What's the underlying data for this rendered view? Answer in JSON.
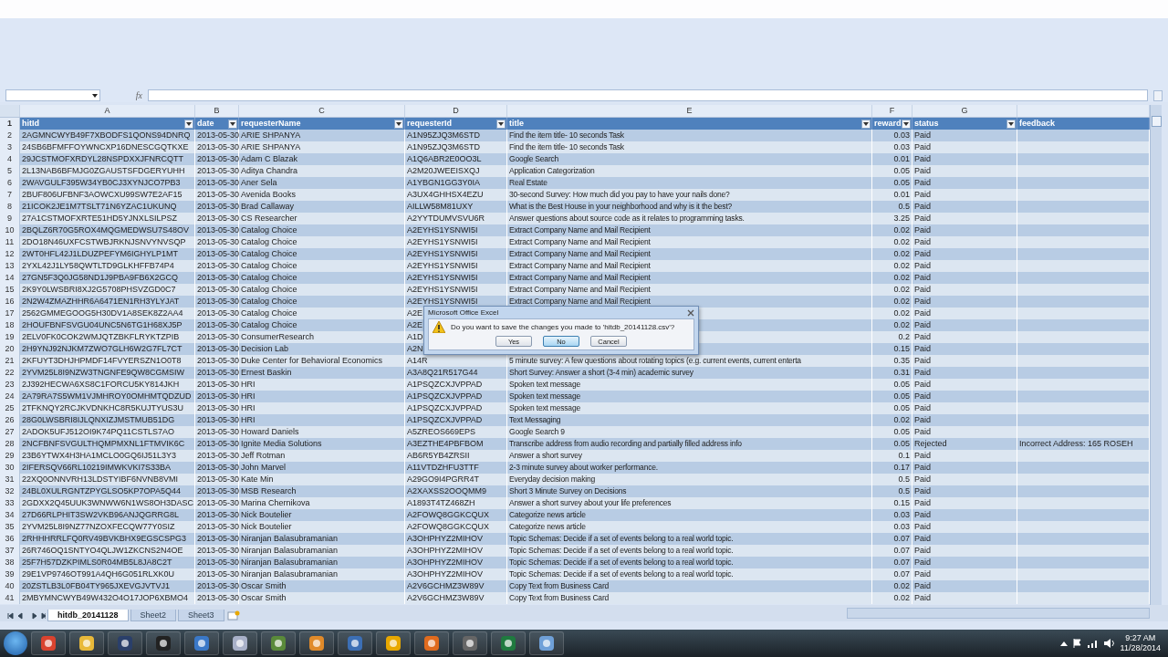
{
  "formula_bar": {
    "fx": "fx"
  },
  "columns": [
    {
      "letter": "A",
      "header": "hitId",
      "filter": true
    },
    {
      "letter": "B",
      "header": "date",
      "filter": true
    },
    {
      "letter": "C",
      "header": "requesterName",
      "filter": true
    },
    {
      "letter": "D",
      "header": "requesterId",
      "filter": true
    },
    {
      "letter": "E",
      "header": "title",
      "filter": true
    },
    {
      "letter": "F",
      "header": "reward",
      "filter": true
    },
    {
      "letter": "G",
      "header": "status",
      "filter": true
    },
    {
      "header": "feedback",
      "filter": false
    }
  ],
  "header_row": "1",
  "rows": [
    {
      "num": "2",
      "a": "2AGMNCWYB49F7XBODFS1QONS94DNRQ",
      "b": "2013-05-30",
      "c": "ARIE SHPANYA",
      "d": "A1N95ZJQ3M6STD",
      "e": "Find the item title- 10 seconds Task",
      "f": "0.03",
      "g": "Paid"
    },
    {
      "num": "3",
      "a": "24SB6BFMFFOYWNCXP16DNESCGQTKXE",
      "b": "2013-05-30",
      "c": "ARIE SHPANYA",
      "d": "A1N95ZJQ3M6STD",
      "e": "Find the item title- 10 seconds Task",
      "f": "0.03",
      "g": "Paid"
    },
    {
      "num": "4",
      "a": "29JCSTMOFXRDYL28NSPDXXJFNRCQTT",
      "b": "2013-05-30",
      "c": "Adam C Blazak",
      "d": "A1Q6ABR2E0OO3L",
      "e": "Google Search",
      "f": "0.01",
      "g": "Paid"
    },
    {
      "num": "5",
      "a": "2L13NAB6BFMJG0ZGAUSTSFDGERYUHH",
      "b": "2013-05-30",
      "c": "Aditya Chandra",
      "d": "A2M20JWEEISXQJ",
      "e": "Application Categorization",
      "f": "0.05",
      "g": "Paid"
    },
    {
      "num": "6",
      "a": "2WAVGULF395W34YB0CJ3XYNJCO7PB3",
      "b": "2013-05-30",
      "c": "Aner Sela",
      "d": "A1YBGN1GG3Y0IA",
      "e": "Real Estate",
      "f": "0.05",
      "g": "Paid"
    },
    {
      "num": "7",
      "a": "2BUF806UFBNF3AOWCXU99SW7E2AF15",
      "b": "2013-05-30",
      "c": "Avenida Books",
      "d": "A3UX4GHHSX4EZU",
      "e": "30-second Survey: How much did you pay to have your nails done?",
      "f": "0.01",
      "g": "Paid"
    },
    {
      "num": "8",
      "a": "21ICOK2JE1M7TSLT71N6YZAC1UKUNQ",
      "b": "2013-05-30",
      "c": "Brad Callaway",
      "d": "AILLW58M81UXY",
      "e": "What is the Best House in your neighborhood and why is it the best?",
      "f": "0.5",
      "g": "Paid"
    },
    {
      "num": "9",
      "a": "27A1CSTMOFXRTE51HD5YJNXLSILPSZ",
      "b": "2013-05-30",
      "c": "CS Researcher",
      "d": "A2YYTDUMVSVU6R",
      "e": "Answer questions about source code as it relates to programming tasks.",
      "f": "3.25",
      "g": "Paid"
    },
    {
      "num": "10",
      "a": "2BQLZ6R70G5ROX4MQGMEDWSU7S48OV",
      "b": "2013-05-30",
      "c": "Catalog Choice",
      "d": "A2EYHS1YSNWI5I",
      "e": "Extract Company Name and Mail Recipient",
      "f": "0.02",
      "g": "Paid"
    },
    {
      "num": "11",
      "a": "2DO18N46UXFCSTWBJRKNJSNVYNVSQP",
      "b": "2013-05-30",
      "c": "Catalog Choice",
      "d": "A2EYHS1YSNWI5I",
      "e": "Extract Company Name and Mail Recipient",
      "f": "0.02",
      "g": "Paid"
    },
    {
      "num": "12",
      "a": "2WT0HFL42J1LDUZPEFYM6IGHYLP1MT",
      "b": "2013-05-30",
      "c": "Catalog Choice",
      "d": "A2EYHS1YSNWI5I",
      "e": "Extract Company Name and Mail Recipient",
      "f": "0.02",
      "g": "Paid"
    },
    {
      "num": "13",
      "a": "2YXL42J1LY58QWTLTD9GLKHFFB74P4",
      "b": "2013-05-30",
      "c": "Catalog Choice",
      "d": "A2EYHS1YSNWI5I",
      "e": "Extract Company Name and Mail Recipient",
      "f": "0.02",
      "g": "Paid"
    },
    {
      "num": "14",
      "a": "27GN5F3Q0JG58ND1J9PBA9FB6X2GCQ",
      "b": "2013-05-30",
      "c": "Catalog Choice",
      "d": "A2EYHS1YSNWI5I",
      "e": "Extract Company Name and Mail Recipient",
      "f": "0.02",
      "g": "Paid"
    },
    {
      "num": "15",
      "a": "2K9Y0LWSBRI8XJ2G5708PHSVZGD0C7",
      "b": "2013-05-30",
      "c": "Catalog Choice",
      "d": "A2EYHS1YSNWI5I",
      "e": "Extract Company Name and Mail Recipient",
      "f": "0.02",
      "g": "Paid"
    },
    {
      "num": "16",
      "a": "2N2W4ZMAZHHR6A6471EN1RH3YLYJAT",
      "b": "2013-05-30",
      "c": "Catalog Choice",
      "d": "A2EYHS1YSNWI5I",
      "e": "Extract Company Name and Mail Recipient",
      "f": "0.02",
      "g": "Paid"
    },
    {
      "num": "17",
      "a": "2562GMMEGOOG5H30DV1A8SEK8Z2AA4",
      "b": "2013-05-30",
      "c": "Catalog Choice",
      "d": "A2E",
      "f": "0.02",
      "g": "Paid"
    },
    {
      "num": "18",
      "a": "2HOUFBNFSVGU04UNC5N6TG1H68XJ5P",
      "b": "2013-05-30",
      "c": "Catalog Choice",
      "d": "A2E",
      "f": "0.02",
      "g": "Paid"
    },
    {
      "num": "19",
      "a": "2ELV0FK0COK2WMJQTZBKFLRYKTZPIB",
      "b": "2013-05-30",
      "c": "ConsumerResearch",
      "d": "A1D",
      "f": "0.2",
      "g": "Paid"
    },
    {
      "num": "20",
      "a": "2H9YNJ92NJKM7ZWO7GLH6W2G7FL7CT",
      "b": "2013-05-30",
      "c": "Decision Lab",
      "d": "A2N",
      "f": "0.15",
      "g": "Paid"
    },
    {
      "num": "21",
      "a": "2KFUYT3DHJHPMDF14FVYERSZN1O0T8",
      "b": "2013-05-30",
      "c": "Duke Center for Behavioral Economics",
      "d": "A14R",
      "e": "5 minute survey: A few questions about rotating topics (e.g. current events,  current enterta",
      "f": "0.35",
      "g": "Paid"
    },
    {
      "num": "22",
      "a": "2YVM25L8I9NZW3TNGNFE9QW8CGMSIW",
      "b": "2013-05-30",
      "c": "Ernest Baskin",
      "d": "A3A8Q21R517G44",
      "e": "Short Survey: Answer a short (3-4 min) academic survey",
      "f": "0.31",
      "g": "Paid"
    },
    {
      "num": "23",
      "a": "2J392HECWA6XS8C1FORCU5KY814JKH",
      "b": "2013-05-30",
      "c": "HRI",
      "d": "A1PSQZCXJVPPAD",
      "e": "Spoken text message",
      "f": "0.05",
      "g": "Paid"
    },
    {
      "num": "24",
      "a": "2A79RA7S5WM1VJMHROY0OMHMTQDZUD",
      "b": "2013-05-30",
      "c": "HRI",
      "d": "A1PSQZCXJVPPAD",
      "e": "Spoken text message",
      "f": "0.05",
      "g": "Paid"
    },
    {
      "num": "25",
      "a": "2TFKNQY2RCJKVDNKHC8R5KUJTYUS3U",
      "b": "2013-05-30",
      "c": "HRI",
      "d": "A1PSQZCXJVPPAD",
      "e": "Spoken text message",
      "f": "0.05",
      "g": "Paid"
    },
    {
      "num": "26",
      "a": "28G0LWSBRI8IJLQNXIZJMSTMUB51DG",
      "b": "2013-05-30",
      "c": "HRI",
      "d": "A1PSQZCXJVPPAD",
      "e": "Text Messaging",
      "f": "0.02",
      "g": "Paid"
    },
    {
      "num": "27",
      "a": "2ADOK5UFJ512OI9K74PQ11CSTLS7AO",
      "b": "2013-05-30",
      "c": "Howard Daniels",
      "d": "A5ZREOS669EPS",
      "e": "Google Search 9",
      "f": "0.05",
      "g": "Paid"
    },
    {
      "num": "28",
      "a": "2NCFBNFSVGULTHQMPMXNL1FTMVIK6C",
      "b": "2013-05-30",
      "c": "Ignite Media Solutions",
      "d": "A3EZTHE4PBFBOM",
      "e": "Transcribe address from audio recording and partially filled address info",
      "f": "0.05",
      "g": "Rejected",
      "h": "Incorrect Address: 165 ROSEH"
    },
    {
      "num": "29",
      "a": "23B6YTWX4H3HA1MCLO0GQ6IJ51L3Y3",
      "b": "2013-05-30",
      "c": "Jeff Rotman",
      "d": "AB6R5YB4ZRSII",
      "e": "Answer a short survey",
      "f": "0.1",
      "g": "Paid"
    },
    {
      "num": "30",
      "a": "2IFERSQV66RL10219IMWKVKI7S33BA",
      "b": "2013-05-30",
      "c": "John Marvel",
      "d": "A11VTDZHFU3TTF",
      "e": "2-3 minute survey about worker performance.",
      "f": "0.17",
      "g": "Paid"
    },
    {
      "num": "31",
      "a": "22XQ0ONNVRH13LDSTYIBF6NVNB8VMI",
      "b": "2013-05-30",
      "c": "Kate Min",
      "d": "A29GO9I4PGRR4T",
      "e": "Everyday decision making",
      "f": "0.5",
      "g": "Paid"
    },
    {
      "num": "32",
      "a": "24BL0XULRGNTZPYGLSO5KP7OPA5Q44",
      "b": "2013-05-30",
      "c": "MSB Research",
      "d": "A2XAXSS2OOQMM9",
      "e": "Short 3 Minute Survey on Decisions",
      "f": "0.5",
      "g": "Paid"
    },
    {
      "num": "33",
      "a": "2GDXX2Q45UUK3WNWW6N1WS8OH3DASC",
      "b": "2013-05-30",
      "c": "Marina Chernikova",
      "d": "A1893T4TZ468ZH",
      "e": "Answer a short survey about your life preferences",
      "f": "0.15",
      "g": "Paid"
    },
    {
      "num": "34",
      "a": "27D66RLPHIT3SW2VKB96ANJQGRRG8L",
      "b": "2013-05-30",
      "c": "Nick Boutelier",
      "d": "A2FOWQ8GGKCQUX",
      "e": "Categorize news article",
      "f": "0.03",
      "g": "Paid"
    },
    {
      "num": "35",
      "a": "2YVM25L8I9NZ77NZOXFECQW77Y0SIZ",
      "b": "2013-05-30",
      "c": "Nick Boutelier",
      "d": "A2FOWQ8GGKCQUX",
      "e": "Categorize news article",
      "f": "0.03",
      "g": "Paid"
    },
    {
      "num": "36",
      "a": "2RHHHRRLFQ0RV49BVKBHX9EGSCSPG3",
      "b": "2013-05-30",
      "c": "Niranjan Balasubramanian",
      "d": "A3OHPHYZ2MIHOV",
      "e": "Topic Schemas: Decide if a set of events belong to a real world topic.",
      "f": "0.07",
      "g": "Paid"
    },
    {
      "num": "37",
      "a": "26R746OQ1SNTYO4QLJW1ZKCNS2N4OE",
      "b": "2013-05-30",
      "c": "Niranjan Balasubramanian",
      "d": "A3OHPHYZ2MIHOV",
      "e": "Topic Schemas: Decide if a set of events belong to a real world topic.",
      "f": "0.07",
      "g": "Paid"
    },
    {
      "num": "38",
      "a": "25F7H57DZKPIMLS0R04MB5L8JA8C2T",
      "b": "2013-05-30",
      "c": "Niranjan Balasubramanian",
      "d": "A3OHPHYZ2MIHOV",
      "e": "Topic Schemas: Decide if a set of events belong to a real world topic.",
      "f": "0.07",
      "g": "Paid"
    },
    {
      "num": "39",
      "a": "29E1VP9746OT991A4QH6G051RLXK0U",
      "b": "2013-05-30",
      "c": "Niranjan Balasubramanian",
      "d": "A3OHPHYZ2MIHOV",
      "e": "Topic Schemas: Decide if a set of events belong to a real world topic.",
      "f": "0.07",
      "g": "Paid"
    },
    {
      "num": "40",
      "a": "20ZSTLB3L0FB04TY965JXEVGJVTVJ1",
      "b": "2013-05-30",
      "c": "Oscar Smith",
      "d": "A2V6GCHMZ3W89V",
      "e": "Copy Text from Business Card",
      "f": "0.02",
      "g": "Paid"
    },
    {
      "num": "41",
      "a": "2MBYMNCWYB49W432O4O17JOP6XBMO4",
      "b": "2013-05-30",
      "c": "Oscar Smith",
      "d": "A2V6GCHMZ3W89V",
      "e": "Copy Text from Business Card",
      "f": "0.02",
      "g": "Paid"
    }
  ],
  "sheet_tabs": [
    {
      "label": "hitdb_20141128",
      "selected": true
    },
    {
      "label": "Sheet2",
      "selected": false
    },
    {
      "label": "Sheet3",
      "selected": false
    }
  ],
  "dialog": {
    "title": "Microsoft Office Excel",
    "message": "Do you want to save the changes you made to 'hitdb_20141128.csv'?",
    "buttons": [
      {
        "label": "Yes",
        "selected": false
      },
      {
        "label": "No",
        "selected": true
      },
      {
        "label": "Cancel",
        "selected": false
      }
    ]
  },
  "taskbar": {
    "time": "9:27 AM",
    "date": "11/28/2014"
  }
}
